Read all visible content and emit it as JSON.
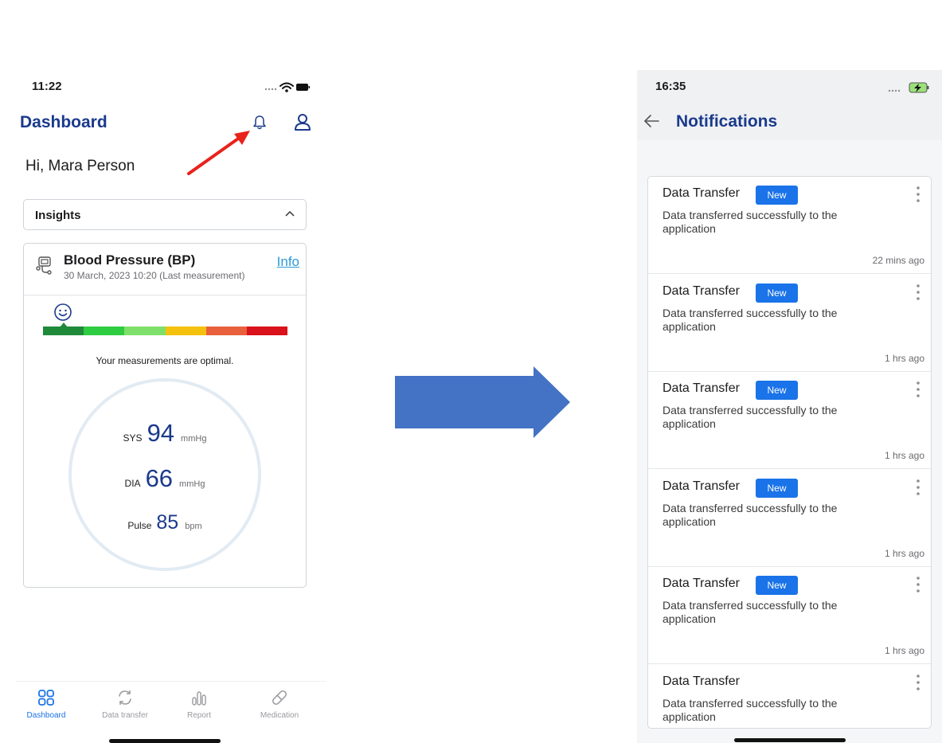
{
  "left_screen": {
    "status_time": "11:22",
    "title": "Dashboard",
    "greeting": "Hi, Mara Person",
    "insights_label": "Insights",
    "bp_card": {
      "title": "Blood Pressure (BP)",
      "subtitle": "30 March, 2023 10:20 (Last measurement)",
      "info_link": "Info",
      "scale_colors": [
        "#1f8a3a",
        "#2ecc40",
        "#7ee06a",
        "#f4c20d",
        "#e8603c",
        "#d9121b"
      ],
      "scale_position": 0.0833,
      "message": "Your measurements are optimal.",
      "sys": {
        "label": "SYS",
        "value": "94",
        "unit": "mmHg"
      },
      "dia": {
        "label": "DIA",
        "value": "66",
        "unit": "mmHg"
      },
      "pulse": {
        "label": "Pulse",
        "value": "85",
        "unit": "bpm"
      }
    },
    "tabs": [
      {
        "label": "Dashboard",
        "icon": "grid-icon",
        "active": true
      },
      {
        "label": "Data transfer",
        "icon": "sync-icon",
        "active": false
      },
      {
        "label": "Report",
        "icon": "bar-chart-icon",
        "active": false
      },
      {
        "label": "Medication",
        "icon": "pill-icon",
        "active": false
      }
    ]
  },
  "right_screen": {
    "status_time": "16:35",
    "title": "Notifications",
    "notifications": [
      {
        "title": "Data Transfer",
        "badge": "New",
        "body": "Data transferred successfully to the application",
        "time": "22 mins ago"
      },
      {
        "title": "Data Transfer",
        "badge": "New",
        "body": "Data transferred successfully to the application",
        "time": "1 hrs ago"
      },
      {
        "title": "Data Transfer",
        "badge": "New",
        "body": "Data transferred successfully to the application",
        "time": "1 hrs ago"
      },
      {
        "title": "Data Transfer",
        "badge": "New",
        "body": "Data transferred successfully to the application",
        "time": "1 hrs ago"
      },
      {
        "title": "Data Transfer",
        "badge": "New",
        "body": "Data transferred successfully to the application",
        "time": "1 hrs ago"
      },
      {
        "title": "Data Transfer",
        "badge": "",
        "body": "Data transferred successfully to the application",
        "time": ""
      }
    ]
  },
  "colors": {
    "brand_navy": "#1a3a8c",
    "accent_blue": "#1a73e8",
    "link_blue": "#2a9bd6",
    "annotation_red": "#e8231b",
    "transition_arrow": "#4472c4"
  }
}
